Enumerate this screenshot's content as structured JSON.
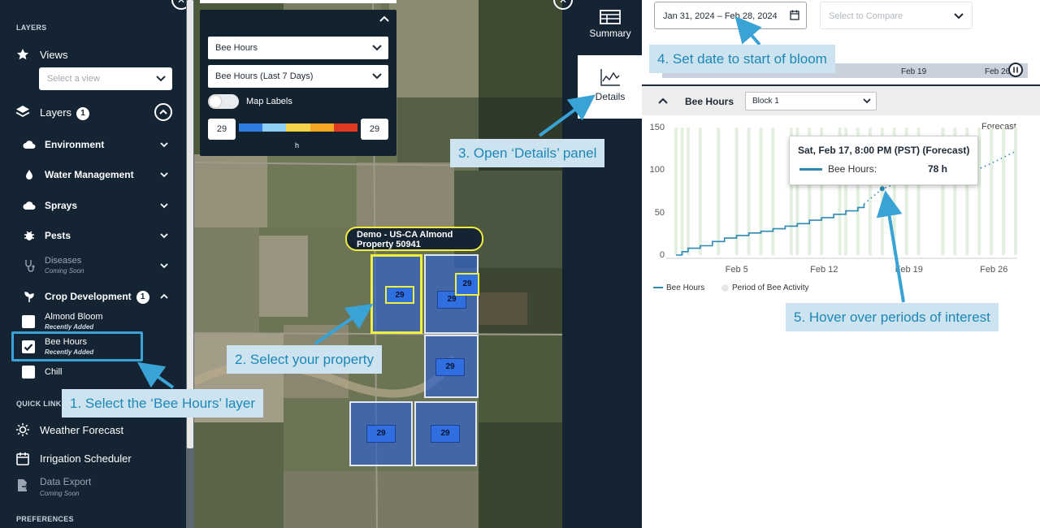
{
  "sidebar": {
    "layers_heading": "LAYERS",
    "views_label": "Views",
    "views_select_placeholder": "Select a view",
    "layers_label": "Layers",
    "layers_badge": "1",
    "items": [
      {
        "label": "Environment",
        "icon": "cloud-icon"
      },
      {
        "label": "Water Management",
        "icon": "water-drop-icon"
      },
      {
        "label": "Sprays",
        "icon": "cloud-icon"
      },
      {
        "label": "Pests",
        "icon": "bug-icon"
      },
      {
        "label": "Diseases",
        "sub": "Coming Soon",
        "icon": "stethoscope-icon"
      },
      {
        "label": "Crop Development",
        "badge": "1",
        "icon": "plant-icon"
      }
    ],
    "crop_items": [
      {
        "label": "Almond Bloom",
        "sub": "Recently Added",
        "checked": false
      },
      {
        "label": "Bee Hours",
        "sub": "Recently Added",
        "checked": true
      },
      {
        "label": "Chill",
        "sub": "",
        "checked": false
      }
    ],
    "quick_links_heading": "QUICK LINKS",
    "quick_links": [
      {
        "label": "Weather Forecast",
        "icon": "sun-icon"
      },
      {
        "label": "Irrigation Scheduler",
        "icon": "calendar-icon"
      },
      {
        "label": "Data Export",
        "sub": "Coming Soon",
        "icon": "export-icon"
      }
    ],
    "preferences_heading": "PREFERENCES"
  },
  "map_panel": {
    "layer_select": "Bee Hours",
    "metric_select": "Bee Hours (Last 7 Days)",
    "map_labels": "Map Labels",
    "legend_min": "29",
    "legend_max": "29",
    "legend_unit": "h",
    "legend_colors": [
      "#2f7de1",
      "#8ecff5",
      "#f5d34a",
      "#f5a623",
      "#e0391f"
    ]
  },
  "map": {
    "property_label_line1": "Demo - US-CA Almond",
    "property_label_line2": "Property 50941",
    "field_values": [
      "29",
      "29",
      "29",
      "29",
      "29",
      "29"
    ]
  },
  "midcol": {
    "summary_label": "Summary",
    "details_label": "Details"
  },
  "right": {
    "date_range": "Jan 31, 2024 – Feb 28, 2024",
    "compare_placeholder": "Select to Compare",
    "timeline_labels": [
      "Feb 19",
      "Feb 26"
    ],
    "panel_title": "Bee Hours",
    "block_select": "Block  1",
    "forecast_label": "Forecast",
    "tooltip": {
      "title": "Sat, Feb 17, 8:00 PM (PST) (Forecast)",
      "series": "Bee Hours:",
      "value": "78 h"
    },
    "legend_bee_hours": "Bee Hours",
    "legend_period": "Period of Bee Activity"
  },
  "chart_data": {
    "type": "line",
    "title": "",
    "xlabel": "",
    "ylabel": "",
    "ylim": [
      0,
      150
    ],
    "y_ticks": [
      0,
      50,
      100,
      150
    ],
    "x_ticks": [
      "Feb 5",
      "Feb 12",
      "Feb 19",
      "Feb 26"
    ],
    "x_range": [
      "Jan 31",
      "Feb 28"
    ],
    "series": [
      {
        "name": "Bee Hours",
        "color": "#2e89b6",
        "x_day": [
          0,
          0.5,
          1,
          2,
          3,
          4,
          5,
          6,
          7,
          8,
          9,
          10,
          11,
          12,
          13,
          14,
          15,
          15.5
        ],
        "values": [
          0,
          4,
          8,
          11,
          16,
          20,
          23,
          26,
          28,
          31,
          34,
          37,
          41,
          44,
          48,
          52,
          56,
          60
        ]
      },
      {
        "name": "Bee Hours (Forecast)",
        "color": "#2e89b6",
        "dashed": true,
        "x_day": [
          15.5,
          17,
          18,
          20,
          22,
          24,
          26,
          28
        ],
        "values": [
          60,
          78,
          83,
          86,
          88,
          95,
          108,
          122
        ]
      }
    ],
    "bee_activity_days": [
      0,
      0.5,
      1,
      2,
      3.5,
      5,
      6,
      7,
      8,
      9.5,
      10,
      11,
      12,
      13.5,
      14,
      15,
      16,
      17,
      18,
      19,
      20,
      22,
      23,
      24,
      25,
      26,
      27,
      28
    ],
    "hover_point": {
      "x_day": 17,
      "value": 78
    }
  },
  "callouts": {
    "step1": "1. Select the ‘Bee Hours’ layer",
    "step2": "2. Select your property",
    "step3": "3. Open ‘Details’ panel",
    "step4": "4. Set date to start of bloom",
    "step5": "5. Hover over periods of interest"
  },
  "colors": {
    "sidebar_bg": "#142433",
    "accent": "#2e89b6",
    "callout_bg": "#cde3ef",
    "callout_text": "#1c88b8",
    "property_outline": "#f2ee3e"
  }
}
